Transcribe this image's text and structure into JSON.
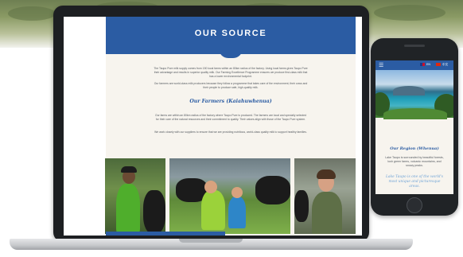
{
  "laptop": {
    "site": {
      "header_title": "OUR SOURCE",
      "intro_paragraphs": [
        "The Taupo Pure milk supply comes from 150 local farms within an 80km radius of the factory. Using local farms gives Taupo Pure their advantage and results in superior quality milk. Our Farming Excellence Programme ensures we produce first-class milk that has a lower environmental footprint.",
        "Our farmers are world-class milk producers because they follow a programme that takes care of the environment, their cows and their people to produce safe, high-quality milk."
      ],
      "farmers_title": "Our Farmers (Kaiahuwhenua)",
      "farmers_paragraphs": [
        "Our farms are within an 80km radius of the factory where Taupo Pure is produced. The farmers are local and specially selected for their care of the natural resources and their commitment to quality. Their values align with those of the Taupo Pure system.",
        "We work closely with our suppliers to ensure that we are providing nutritious, world-class quality milk to support healthy families."
      ]
    }
  },
  "phone": {
    "nav": {
      "menu_icon": "☰",
      "lang_en": "EN",
      "lang_cn": "中文"
    },
    "region_title": "Our Region (Whenua)",
    "region_text": "Lake Taupo is surrounded by beautiful forests, lush green farms, volcanic mountains, and snowy peaks.",
    "region_quote": "Lake Taupo is one of the world's most unique and picturesque areas."
  },
  "colors": {
    "brand_blue": "#2b5ca3",
    "cream": "#f7f4ee",
    "quote_blue": "#6fa3d6"
  },
  "icons": [
    "hamburger-menu-icon",
    "flag-nz-icon",
    "flag-cn-icon"
  ]
}
